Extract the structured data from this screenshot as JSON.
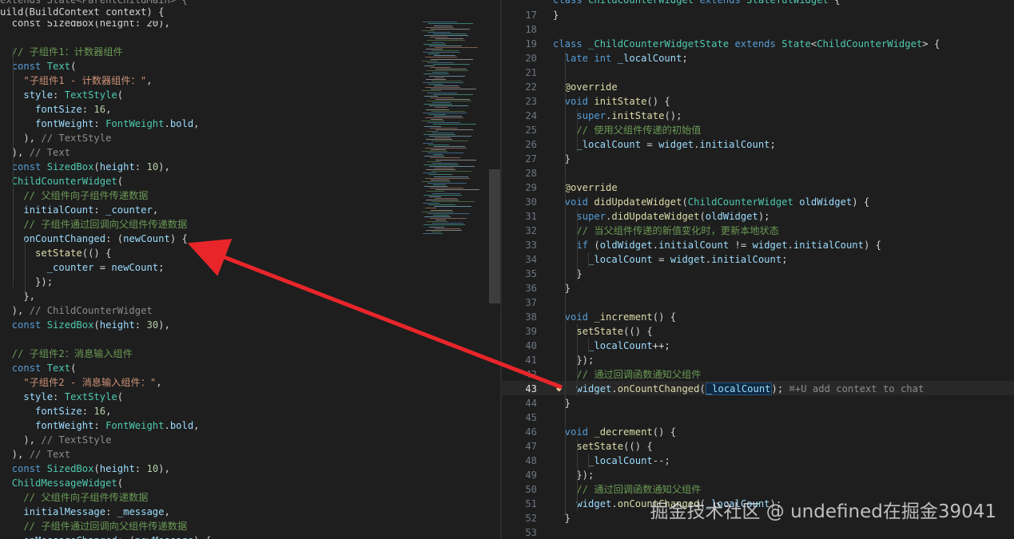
{
  "left": {
    "header": [
      {
        "t": "extends State<ParentChildMain> {",
        "c": "c-ph"
      },
      {
        "t": "uild(BuildContext context) {",
        "c": "c-pl"
      }
    ],
    "lines": [
      [
        [
          "  const SizedBox(height: 20),",
          "c-pl"
        ]
      ],
      [
        [
          "",
          ""
        ]
      ],
      [
        [
          "  // 子组件1：计数器组件",
          "c-cm"
        ]
      ],
      [
        [
          "  ",
          "c-pl"
        ],
        [
          "const ",
          "c-kw"
        ],
        [
          "Text",
          "c-ty"
        ],
        [
          "(",
          "c-pl"
        ]
      ],
      [
        [
          "    ",
          "c-pl"
        ],
        [
          "\"子组件1 - 计数器组件：\"",
          "c-st"
        ],
        [
          ",",
          "c-pl"
        ]
      ],
      [
        [
          "    ",
          "c-pl"
        ],
        [
          "style",
          "c-pr"
        ],
        [
          ": ",
          "c-pl"
        ],
        [
          "TextStyle",
          "c-ty"
        ],
        [
          "(",
          "c-pl"
        ]
      ],
      [
        [
          "      ",
          "c-pl"
        ],
        [
          "fontSize",
          "c-pr"
        ],
        [
          ": ",
          "c-pl"
        ],
        [
          "16",
          "c-nu"
        ],
        [
          ",",
          "c-pl"
        ]
      ],
      [
        [
          "      ",
          "c-pl"
        ],
        [
          "fontWeight",
          "c-pr"
        ],
        [
          ": ",
          "c-pl"
        ],
        [
          "FontWeight",
          "c-ty"
        ],
        [
          ".",
          "c-pl"
        ],
        [
          "bold",
          "c-pr"
        ],
        [
          ",",
          "c-pl"
        ]
      ],
      [
        [
          "    ), ",
          "c-pl"
        ],
        [
          "// TextStyle",
          "c-ph"
        ]
      ],
      [
        [
          "  ), ",
          "c-pl"
        ],
        [
          "// Text",
          "c-ph"
        ]
      ],
      [
        [
          "  ",
          "c-pl"
        ],
        [
          "const ",
          "c-kw"
        ],
        [
          "SizedBox",
          "c-ty"
        ],
        [
          "(",
          "c-pl"
        ],
        [
          "height",
          "c-pr"
        ],
        [
          ": ",
          "c-pl"
        ],
        [
          "10",
          "c-nu"
        ],
        [
          "),",
          "c-pl"
        ]
      ],
      [
        [
          "  ",
          "c-pl"
        ],
        [
          "ChildCounterWidget",
          "c-ty"
        ],
        [
          "(",
          "c-pl"
        ]
      ],
      [
        [
          "    // 父组件向子组件传递数据",
          "c-cm"
        ]
      ],
      [
        [
          "    ",
          "c-pl"
        ],
        [
          "initialCount",
          "c-pr"
        ],
        [
          ": ",
          "c-pl"
        ],
        [
          "_counter",
          "c-pr"
        ],
        [
          ",",
          "c-pl"
        ]
      ],
      [
        [
          "    // 子组件通过回调向父组件传递数据",
          "c-cm"
        ]
      ],
      [
        [
          "    ",
          "c-pl"
        ],
        [
          "onCountChanged",
          "c-pr"
        ],
        [
          ": (",
          "c-pl"
        ],
        [
          "newCount",
          "c-pr"
        ],
        [
          ") {",
          "c-pl"
        ]
      ],
      [
        [
          "      ",
          "c-pl"
        ],
        [
          "setState",
          "c-fn"
        ],
        [
          "(() {",
          "c-pl"
        ]
      ],
      [
        [
          "        ",
          "c-pl"
        ],
        [
          "_counter",
          "c-pr"
        ],
        [
          " = ",
          "c-pl"
        ],
        [
          "newCount",
          "c-pr"
        ],
        [
          ";",
          "c-pl"
        ]
      ],
      [
        [
          "      });",
          "c-pl"
        ]
      ],
      [
        [
          "    },",
          "c-pl"
        ]
      ],
      [
        [
          "  ), ",
          "c-pl"
        ],
        [
          "// ChildCounterWidget",
          "c-ph"
        ]
      ],
      [
        [
          "  ",
          "c-pl"
        ],
        [
          "const ",
          "c-kw"
        ],
        [
          "SizedBox",
          "c-ty"
        ],
        [
          "(",
          "c-pl"
        ],
        [
          "height",
          "c-pr"
        ],
        [
          ": ",
          "c-pl"
        ],
        [
          "30",
          "c-nu"
        ],
        [
          "),",
          "c-pl"
        ]
      ],
      [
        [
          "",
          ""
        ]
      ],
      [
        [
          "  // 子组件2：消息输入组件",
          "c-cm"
        ]
      ],
      [
        [
          "  ",
          "c-pl"
        ],
        [
          "const ",
          "c-kw"
        ],
        [
          "Text",
          "c-ty"
        ],
        [
          "(",
          "c-pl"
        ]
      ],
      [
        [
          "    ",
          "c-pl"
        ],
        [
          "\"子组件2 - 消息输入组件：\"",
          "c-st"
        ],
        [
          ",",
          "c-pl"
        ]
      ],
      [
        [
          "    ",
          "c-pl"
        ],
        [
          "style",
          "c-pr"
        ],
        [
          ": ",
          "c-pl"
        ],
        [
          "TextStyle",
          "c-ty"
        ],
        [
          "(",
          "c-pl"
        ]
      ],
      [
        [
          "      ",
          "c-pl"
        ],
        [
          "fontSize",
          "c-pr"
        ],
        [
          ": ",
          "c-pl"
        ],
        [
          "16",
          "c-nu"
        ],
        [
          ",",
          "c-pl"
        ]
      ],
      [
        [
          "      ",
          "c-pl"
        ],
        [
          "fontWeight",
          "c-pr"
        ],
        [
          ": ",
          "c-pl"
        ],
        [
          "FontWeight",
          "c-ty"
        ],
        [
          ".",
          "c-pl"
        ],
        [
          "bold",
          "c-pr"
        ],
        [
          ",",
          "c-pl"
        ]
      ],
      [
        [
          "    ), ",
          "c-pl"
        ],
        [
          "// TextStyle",
          "c-ph"
        ]
      ],
      [
        [
          "  ), ",
          "c-pl"
        ],
        [
          "// Text",
          "c-ph"
        ]
      ],
      [
        [
          "  ",
          "c-pl"
        ],
        [
          "const ",
          "c-kw"
        ],
        [
          "SizedBox",
          "c-ty"
        ],
        [
          "(",
          "c-pl"
        ],
        [
          "height",
          "c-pr"
        ],
        [
          ": ",
          "c-pl"
        ],
        [
          "10",
          "c-nu"
        ],
        [
          "),",
          "c-pl"
        ]
      ],
      [
        [
          "  ",
          "c-pl"
        ],
        [
          "ChildMessageWidget",
          "c-ty"
        ],
        [
          "(",
          "c-pl"
        ]
      ],
      [
        [
          "    // 父组件向子组件传递数据",
          "c-cm"
        ]
      ],
      [
        [
          "    ",
          "c-pl"
        ],
        [
          "initialMessage",
          "c-pr"
        ],
        [
          ": ",
          "c-pl"
        ],
        [
          "_message",
          "c-pr"
        ],
        [
          ",",
          "c-pl"
        ]
      ],
      [
        [
          "    // 子组件通过回调向父组件传递数据",
          "c-cm"
        ]
      ],
      [
        [
          "    ",
          "c-pl"
        ],
        [
          "onMessageChanged",
          "c-pr"
        ],
        [
          ": (",
          "c-pl"
        ],
        [
          "newMessage",
          "c-pr"
        ],
        [
          ") {",
          "c-pl"
        ]
      ]
    ]
  },
  "right": {
    "active_line": 43,
    "header": [
      [
        "class ",
        "c-kw"
      ],
      [
        "ChildCounterWidget ",
        "c-ty"
      ],
      [
        "extends ",
        "c-kw"
      ],
      [
        "StatefulWidget ",
        "c-ty"
      ],
      [
        "{",
        "c-pl"
      ]
    ],
    "lines": [
      {
        "n": 17,
        "s": [
          [
            "}",
            "c-pl"
          ]
        ]
      },
      {
        "n": 18,
        "s": [
          [
            "",
            ""
          ]
        ]
      },
      {
        "n": 19,
        "s": [
          [
            "class ",
            "c-kw"
          ],
          [
            "_ChildCounterWidgetState ",
            "c-ty"
          ],
          [
            "extends ",
            "c-kw"
          ],
          [
            "State",
            "c-ty"
          ],
          [
            "<",
            "c-pl"
          ],
          [
            "ChildCounterWidget",
            "c-ty"
          ],
          [
            "> {",
            "c-pl"
          ]
        ]
      },
      {
        "n": 20,
        "s": [
          [
            "  late ",
            "c-kw"
          ],
          [
            "int ",
            "c-kw"
          ],
          [
            "_localCount",
            "c-pr"
          ],
          [
            ";",
            "c-pl"
          ]
        ]
      },
      {
        "n": 21,
        "s": [
          [
            "",
            ""
          ]
        ]
      },
      {
        "n": 22,
        "s": [
          [
            "  @override",
            "c-an"
          ]
        ]
      },
      {
        "n": 23,
        "s": [
          [
            "  void ",
            "c-kw"
          ],
          [
            "initState",
            "c-fn"
          ],
          [
            "() {",
            "c-pl"
          ]
        ]
      },
      {
        "n": 24,
        "s": [
          [
            "    ",
            "c-pl"
          ],
          [
            "super",
            "c-kw"
          ],
          [
            ".",
            "c-pl"
          ],
          [
            "initState",
            "c-fn"
          ],
          [
            "();",
            "c-pl"
          ]
        ]
      },
      {
        "n": 25,
        "s": [
          [
            "    // 使用父组件传递的初始值",
            "c-cm"
          ]
        ]
      },
      {
        "n": 26,
        "s": [
          [
            "    ",
            "c-pl"
          ],
          [
            "_localCount",
            "c-pr"
          ],
          [
            " = ",
            "c-pl"
          ],
          [
            "widget",
            "c-pr"
          ],
          [
            ".",
            "c-pl"
          ],
          [
            "initialCount",
            "c-pr"
          ],
          [
            ";",
            "c-pl"
          ]
        ]
      },
      {
        "n": 27,
        "s": [
          [
            "  }",
            "c-pl"
          ]
        ]
      },
      {
        "n": 28,
        "s": [
          [
            "",
            ""
          ]
        ]
      },
      {
        "n": 29,
        "s": [
          [
            "  @override",
            "c-an"
          ]
        ]
      },
      {
        "n": 30,
        "s": [
          [
            "  void ",
            "c-kw"
          ],
          [
            "didUpdateWidget",
            "c-fn"
          ],
          [
            "(",
            "c-pl"
          ],
          [
            "ChildCounterWidget ",
            "c-ty"
          ],
          [
            "oldWidget",
            "c-pr"
          ],
          [
            ") {",
            "c-pl"
          ]
        ]
      },
      {
        "n": 31,
        "s": [
          [
            "    ",
            "c-pl"
          ],
          [
            "super",
            "c-kw"
          ],
          [
            ".",
            "c-pl"
          ],
          [
            "didUpdateWidget",
            "c-fn"
          ],
          [
            "(",
            "c-pl"
          ],
          [
            "oldWidget",
            "c-pr"
          ],
          [
            ");",
            "c-pl"
          ]
        ]
      },
      {
        "n": 32,
        "s": [
          [
            "    // 当父组件传递的新值变化时，更新本地状态",
            "c-cm"
          ]
        ]
      },
      {
        "n": 33,
        "s": [
          [
            "    if ",
            "c-kw"
          ],
          [
            "(",
            "c-pl"
          ],
          [
            "oldWidget",
            "c-pr"
          ],
          [
            ".",
            "c-pl"
          ],
          [
            "initialCount",
            "c-pr"
          ],
          [
            " != ",
            "c-pl"
          ],
          [
            "widget",
            "c-pr"
          ],
          [
            ".",
            "c-pl"
          ],
          [
            "initialCount",
            "c-pr"
          ],
          [
            ") {",
            "c-pl"
          ]
        ]
      },
      {
        "n": 34,
        "s": [
          [
            "      ",
            "c-pl"
          ],
          [
            "_localCount",
            "c-pr"
          ],
          [
            " = ",
            "c-pl"
          ],
          [
            "widget",
            "c-pr"
          ],
          [
            ".",
            "c-pl"
          ],
          [
            "initialCount",
            "c-pr"
          ],
          [
            ";",
            "c-pl"
          ]
        ]
      },
      {
        "n": 35,
        "s": [
          [
            "    }",
            "c-pl"
          ]
        ]
      },
      {
        "n": 36,
        "s": [
          [
            "  }",
            "c-pl"
          ]
        ]
      },
      {
        "n": 37,
        "s": [
          [
            "",
            ""
          ]
        ]
      },
      {
        "n": 38,
        "s": [
          [
            "  void ",
            "c-kw"
          ],
          [
            "_increment",
            "c-fn"
          ],
          [
            "() {",
            "c-pl"
          ]
        ]
      },
      {
        "n": 39,
        "s": [
          [
            "    ",
            "c-pl"
          ],
          [
            "setState",
            "c-fn"
          ],
          [
            "(() {",
            "c-pl"
          ]
        ]
      },
      {
        "n": 40,
        "s": [
          [
            "      ",
            "c-pl"
          ],
          [
            "_localCount",
            "c-pr"
          ],
          [
            "++;",
            "c-pl"
          ]
        ]
      },
      {
        "n": 41,
        "s": [
          [
            "    });",
            "c-pl"
          ]
        ]
      },
      {
        "n": 42,
        "s": [
          [
            "    // 通过回调函数通知父组件",
            "c-cm"
          ]
        ]
      },
      {
        "n": 43,
        "s": [
          [
            "    ",
            "c-pl"
          ],
          [
            "widget",
            "c-pr"
          ],
          [
            ".",
            "c-pl"
          ],
          [
            "onCountChanged",
            "c-fn"
          ],
          [
            "(",
            "c-pl"
          ],
          [
            "_localCount",
            "c-pr hl"
          ],
          [
            ");",
            "c-pl"
          ],
          [
            " ⌘+U add context to chat",
            "c-ph"
          ]
        ]
      },
      {
        "n": 44,
        "s": [
          [
            "  }",
            "c-pl"
          ]
        ]
      },
      {
        "n": 45,
        "s": [
          [
            "",
            ""
          ]
        ]
      },
      {
        "n": 46,
        "s": [
          [
            "  void ",
            "c-kw"
          ],
          [
            "_decrement",
            "c-fn"
          ],
          [
            "() {",
            "c-pl"
          ]
        ]
      },
      {
        "n": 47,
        "s": [
          [
            "    ",
            "c-pl"
          ],
          [
            "setState",
            "c-fn"
          ],
          [
            "(() {",
            "c-pl"
          ]
        ]
      },
      {
        "n": 48,
        "s": [
          [
            "      ",
            "c-pl"
          ],
          [
            "_localCount",
            "c-pr"
          ],
          [
            "--;",
            "c-pl"
          ]
        ]
      },
      {
        "n": 49,
        "s": [
          [
            "    });",
            "c-pl"
          ]
        ]
      },
      {
        "n": 50,
        "s": [
          [
            "    // 通过回调函数通知父组件",
            "c-cm"
          ]
        ]
      },
      {
        "n": 51,
        "s": [
          [
            "    ",
            "c-pl"
          ],
          [
            "widget",
            "c-pr"
          ],
          [
            ".",
            "c-pl"
          ],
          [
            "onCountChanged",
            "c-fn"
          ],
          [
            "(",
            "c-pl"
          ],
          [
            "_localCount",
            "c-pr"
          ],
          [
            ");",
            "c-pl"
          ]
        ]
      },
      {
        "n": 52,
        "s": [
          [
            "  }",
            "c-pl"
          ]
        ]
      },
      {
        "n": 53,
        "s": [
          [
            "",
            ""
          ]
        ]
      }
    ]
  },
  "annotation": {
    "color": "#e8262a"
  },
  "watermark": "掘金技术社区 @ undefined在掘金39041"
}
